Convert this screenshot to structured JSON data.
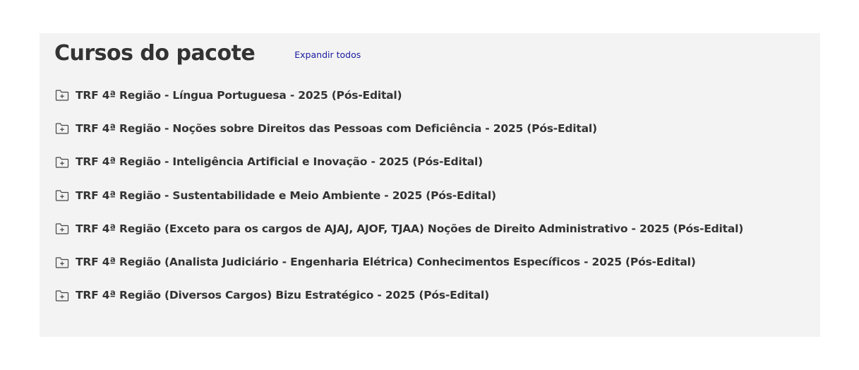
{
  "section": {
    "title": "Cursos do pacote",
    "expand_all_label": "Expandir todos"
  },
  "courses": [
    {
      "title": "TRF 4ª Região - Língua Portuguesa - 2025 (Pós-Edital)",
      "icon": "folder-plus-icon"
    },
    {
      "title": "TRF 4ª Região - Noções sobre Direitos das Pessoas com Deficiência - 2025 (Pós-Edital)",
      "icon": "folder-plus-icon"
    },
    {
      "title": "TRF 4ª Região - Inteligência Artificial e Inovação - 2025 (Pós-Edital)",
      "icon": "folder-plus-icon"
    },
    {
      "title": "TRF 4ª Região - Sustentabilidade e Meio Ambiente - 2025 (Pós-Edital)",
      "icon": "folder-plus-icon"
    },
    {
      "title": "TRF 4ª Região (Exceto para os cargos de AJAJ, AJOF, TJAA) Noções de Direito Administrativo - 2025 (Pós-Edital)",
      "icon": "folder-plus-icon"
    },
    {
      "title": "TRF 4ª Região (Analista Judiciário - Engenharia Elétrica) Conhecimentos Específicos - 2025 (Pós-Edital)",
      "icon": "folder-plus-icon"
    },
    {
      "title": "TRF 4ª Região (Diversos Cargos) Bizu Estratégico - 2025 (Pós-Edital)",
      "icon": "folder-plus-icon"
    }
  ],
  "colors": {
    "panel_background": "#f3f3f3",
    "text": "#333333",
    "link": "#1a1aa0"
  }
}
